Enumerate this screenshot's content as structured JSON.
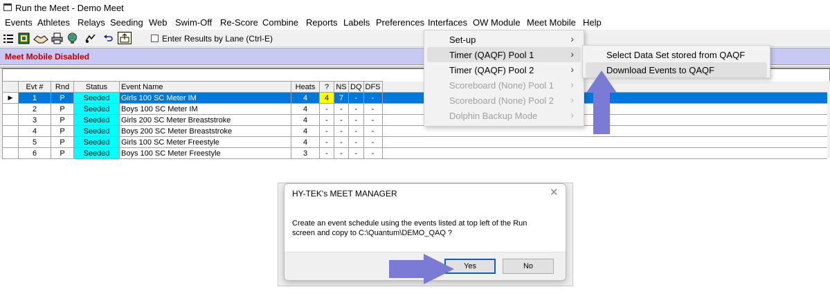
{
  "window": {
    "title": "Run the Meet - Demo Meet"
  },
  "menubar": [
    "Events",
    "Athletes",
    "Relays",
    "Seeding",
    "Web",
    "Swim-Off",
    "Re-Score",
    "Combine",
    "Reports",
    "Labels",
    "Preferences",
    "Interfaces",
    "OW Module",
    "Meet Mobile",
    "Help"
  ],
  "toolbar": {
    "icons": [
      "grid-icon",
      "scoreboard-icon",
      "handshake-icon",
      "printer-icon",
      "globe-icon",
      "relay-icon",
      "undo-icon",
      "export-icon"
    ],
    "lane_checkbox_label": "Enter Results by Lane (Ctrl-E)",
    "lane_checked": false
  },
  "status_strip": {
    "text": "Meet Mobile Disabled",
    "color": "#c00000"
  },
  "events_table": {
    "headers": [
      "Evt #",
      "Rnd",
      "Status",
      "Event Name",
      "Heats",
      "?",
      "NS",
      "DQ",
      "DFS"
    ],
    "selected_row": 0,
    "rows": [
      [
        "1",
        "P",
        "Seeded",
        "Girls 100 SC Meter IM",
        "4",
        "4",
        "7",
        "-",
        "-"
      ],
      [
        "2",
        "P",
        "Seeded",
        "Boys 100 SC Meter IM",
        "4",
        "-",
        "-",
        "-",
        "-"
      ],
      [
        "3",
        "P",
        "Seeded",
        "Girls 200 SC Meter Breaststroke",
        "4",
        "-",
        "-",
        "-",
        "-"
      ],
      [
        "4",
        "P",
        "Seeded",
        "Boys 200 SC Meter Breaststroke",
        "4",
        "-",
        "-",
        "-",
        "-"
      ],
      [
        "5",
        "P",
        "Seeded",
        "Girls 100 SC Meter Freestyle",
        "4",
        "-",
        "-",
        "-",
        "-"
      ],
      [
        "6",
        "P",
        "Seeded",
        "Boys 100 SC Meter Freestyle",
        "3",
        "-",
        "-",
        "-",
        "-"
      ]
    ]
  },
  "interfaces_menu": {
    "items": [
      {
        "label": "Set-up",
        "enabled": true,
        "hover": false
      },
      {
        "label": "Timer (QAQF) Pool 1",
        "enabled": true,
        "hover": true
      },
      {
        "label": "Timer (QAQF) Pool 2",
        "enabled": true,
        "hover": false
      },
      {
        "label": "Scoreboard (None) Pool 1",
        "enabled": false,
        "hover": false
      },
      {
        "label": "Scoreboard (None) Pool 2",
        "enabled": false,
        "hover": false
      },
      {
        "label": "Dolphin Backup Mode",
        "enabled": false,
        "hover": false
      }
    ],
    "arrow_glyph": "›"
  },
  "timer_submenu": {
    "items": [
      {
        "label": "Select Data Set stored from QAQF",
        "hover": false
      },
      {
        "label": "Download Events to QAQF",
        "hover": true
      }
    ]
  },
  "dialog": {
    "title": "HY-TEK's MEET MANAGER",
    "close_glyph": "✕",
    "message_line1": "Create an event schedule using the events listed at top left of the Run",
    "message_line2": "screen and copy to C:\\Quantum\\DEMO_QAQ ?",
    "yes_label": "Yes",
    "no_label": "No"
  },
  "colors": {
    "selection": "#0078d7",
    "seeded": "#00ffff",
    "question_highlight": "#ffff00",
    "callout_arrow": "#7b7bd6",
    "status_strip_bg": "#c8c8f4"
  }
}
